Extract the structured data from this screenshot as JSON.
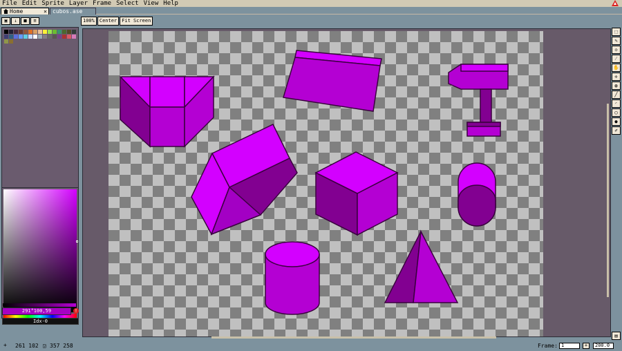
{
  "menu": [
    "File",
    "Edit",
    "Sprite",
    "Layer",
    "Frame",
    "Select",
    "View",
    "Help"
  ],
  "tabs": {
    "home": "Home",
    "file": "cubos.ase"
  },
  "palette_tools": [
    "lock-icon",
    "sort-icon",
    "options-icon",
    "menu-icon"
  ],
  "palette": [
    "#000000",
    "#222034",
    "#45283c",
    "#663931",
    "#8f563b",
    "#df7126",
    "#d9a066",
    "#eec39a",
    "#fbf236",
    "#99e550",
    "#6abe30",
    "#37946e",
    "#4b692f",
    "#524b24",
    "#323c39",
    "#3f3f74",
    "#306082",
    "#5b6ee1",
    "#639bff",
    "#5fcde4",
    "#cbdbfc",
    "#ffffff",
    "#9badb7",
    "#847e87",
    "#696a6a",
    "#595652",
    "#76428a",
    "#ac3232",
    "#d95763",
    "#d77bba",
    "#8f974a",
    "#8a6f30"
  ],
  "color_value": "291°100,59",
  "index_value": "Idx-0",
  "canvas_toolbar": [
    "100%",
    "Center",
    "Fit Screen"
  ],
  "tools": [
    "marquee-icon",
    "pencil-icon",
    "eraser-icon",
    "eyedropper-icon",
    "hand-icon",
    "move-icon",
    "bucket-icon",
    "line-icon",
    "curve-icon",
    "ellipse-icon",
    "blur-icon",
    "ink-icon"
  ],
  "status": {
    "position": "261 102",
    "size": "357 258",
    "frame_label": "Frame:",
    "frame_value": "1",
    "zoom_value": "200.0"
  },
  "colors": {
    "purple_light": "#d300ff",
    "purple_mid": "#b400d3",
    "purple_dark": "#820091",
    "checker_light": "#c0c0c0",
    "checker_dark": "#808080"
  }
}
